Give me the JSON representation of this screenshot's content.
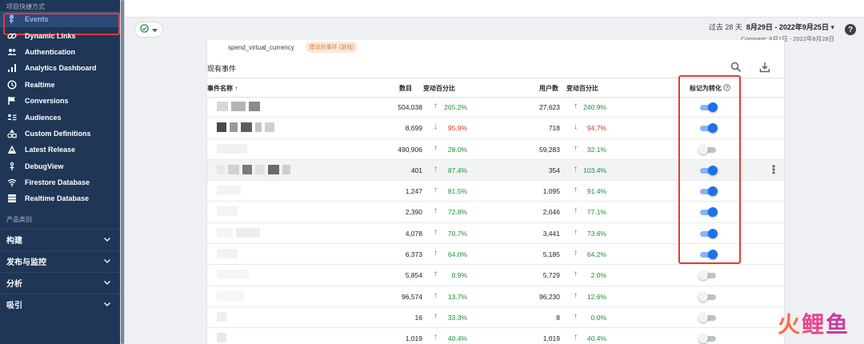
{
  "sidebar": {
    "section_title": "项目快捷方式",
    "items": [
      {
        "label": "Events",
        "icon": "events-icon",
        "active": true
      },
      {
        "label": "Dynamic Links",
        "icon": "link-icon"
      },
      {
        "label": "Authentication",
        "icon": "people-icon"
      },
      {
        "label": "Analytics Dashboard",
        "icon": "bar-chart-icon"
      },
      {
        "label": "Realtime",
        "icon": "clock-icon"
      },
      {
        "label": "Conversions",
        "icon": "flag-icon"
      },
      {
        "label": "Audiences",
        "icon": "audience-list-icon"
      },
      {
        "label": "Custom Definitions",
        "icon": "custom-definitions-icon"
      },
      {
        "label": "Latest Release",
        "icon": "release-icon"
      },
      {
        "label": "DebugView",
        "icon": "debug-icon"
      },
      {
        "label": "Firestore Database",
        "icon": "wifi-icon"
      },
      {
        "label": "Realtime Database",
        "icon": "database-icon"
      }
    ],
    "section2_title": "产品类别",
    "groups": [
      {
        "label": "构建"
      },
      {
        "label": "发布与监控"
      },
      {
        "label": "分析"
      },
      {
        "label": "吸引"
      }
    ]
  },
  "filter": {
    "date_prefix": "过去 28 天",
    "date_range": "8月29日 - 2022年9月25日",
    "compare": "Compare: 8月1日 - 2022年8月28日"
  },
  "suggestion": {
    "event_name": "spend_virtual_currency",
    "badge": "建议的事件 (游戏)"
  },
  "card": {
    "title": "现有事件"
  },
  "table": {
    "headers": {
      "name": "事件名称",
      "count": "数目",
      "count_change": "变动百分比",
      "users": "用户数",
      "users_change": "变动百分比",
      "conversion": "标记为转化"
    },
    "rows": [
      {
        "count": "504,038",
        "count_dir": "up",
        "count_change": "265.2%",
        "users": "27,623",
        "users_dir": "up",
        "users_change": "240.9%",
        "conversion": true
      },
      {
        "count": "8,699",
        "count_dir": "down",
        "count_change": "95.9%",
        "users": "718",
        "users_dir": "down",
        "users_change": "94.7%",
        "conversion": true
      },
      {
        "count": "490,906",
        "count_dir": "up",
        "count_change": "28.0%",
        "users": "59,283",
        "users_dir": "up",
        "users_change": "32.1%",
        "conversion": false
      },
      {
        "count": "401",
        "count_dir": "up",
        "count_change": "87.4%",
        "users": "354",
        "users_dir": "up",
        "users_change": "103.4%",
        "conversion": true,
        "highlight": true
      },
      {
        "count": "1,247",
        "count_dir": "up",
        "count_change": "81.5%",
        "users": "1,095",
        "users_dir": "up",
        "users_change": "91.4%",
        "conversion": true
      },
      {
        "count": "2,390",
        "count_dir": "up",
        "count_change": "72.8%",
        "users": "2,046",
        "users_dir": "up",
        "users_change": "77.1%",
        "conversion": true
      },
      {
        "count": "4,078",
        "count_dir": "up",
        "count_change": "70.7%",
        "users": "3,441",
        "users_dir": "up",
        "users_change": "73.6%",
        "conversion": true
      },
      {
        "count": "6,373",
        "count_dir": "up",
        "count_change": "64.0%",
        "users": "5,185",
        "users_dir": "up",
        "users_change": "64.2%",
        "conversion": true
      },
      {
        "count": "5,854",
        "count_dir": "up",
        "count_change": "0.9%",
        "users": "5,729",
        "users_dir": "up",
        "users_change": "2.0%",
        "conversion": false
      },
      {
        "count": "96,574",
        "count_dir": "up",
        "count_change": "13.7%",
        "users": "96,230",
        "users_dir": "up",
        "users_change": "12.6%",
        "conversion": false
      },
      {
        "count": "16",
        "count_dir": "up",
        "count_change": "33.3%",
        "users": "8",
        "users_dir": "up",
        "users_change": "0.0%",
        "conversion": false
      },
      {
        "count": "1,019",
        "count_dir": "up",
        "count_change": "40.4%",
        "users": "1,019",
        "users_dir": "up",
        "users_change": "40.4%",
        "conversion": false
      }
    ]
  },
  "colors": {
    "sidebar_bg": "#1f3656",
    "accent": "#1a73e8",
    "highlight_box": "#e53935",
    "up": "#1e8e3e",
    "down": "#d93025"
  },
  "watermark": {
    "text": "火鲤鱼"
  }
}
